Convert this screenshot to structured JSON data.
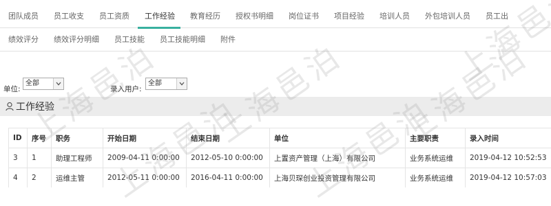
{
  "tabs_row1": [
    {
      "label": "团队成员"
    },
    {
      "label": "员工收支"
    },
    {
      "label": "员工资质"
    },
    {
      "label": "工作经验",
      "active": true
    },
    {
      "label": "教育经历"
    },
    {
      "label": "授权书明细"
    },
    {
      "label": "岗位证书"
    },
    {
      "label": "项目经验"
    },
    {
      "label": "培训人员"
    },
    {
      "label": "外包培训人员"
    },
    {
      "label": "员工出"
    }
  ],
  "tabs_row2": [
    {
      "label": "绩效评分"
    },
    {
      "label": "绩效评分明细"
    },
    {
      "label": "员工技能"
    },
    {
      "label": "员工技能明细"
    },
    {
      "label": "附件"
    }
  ],
  "filters": {
    "unit_label": "单位:",
    "unit_value": "全部",
    "user_label": "录入用户:",
    "user_value": "全部"
  },
  "panel": {
    "title": "工作经验",
    "icon": "user-icon"
  },
  "table": {
    "headers": [
      "ID",
      "序号",
      "职务",
      "开始日期",
      "结束日期",
      "单位",
      "主要职责",
      "录入时间"
    ],
    "rows": [
      [
        "3",
        "1",
        "助理工程师",
        "2009-04-11 0:00:00",
        "2012-05-10 0:00:00",
        "上置资产管理（上海）有限公司",
        "业务系统运维",
        "2019-04-12 10:52:53"
      ],
      [
        "4",
        "2",
        "运维主管",
        "2012-05-11 0:00:00",
        "2016-04-11 0:00:00",
        "上海贝琛创业投资管理有限公司",
        "业务系统运维",
        "2019-04-12 10:57:03"
      ]
    ]
  },
  "watermark": "上海邑泊",
  "colors": {
    "accent": "#38b09f",
    "panel_bg": "#ececec"
  }
}
